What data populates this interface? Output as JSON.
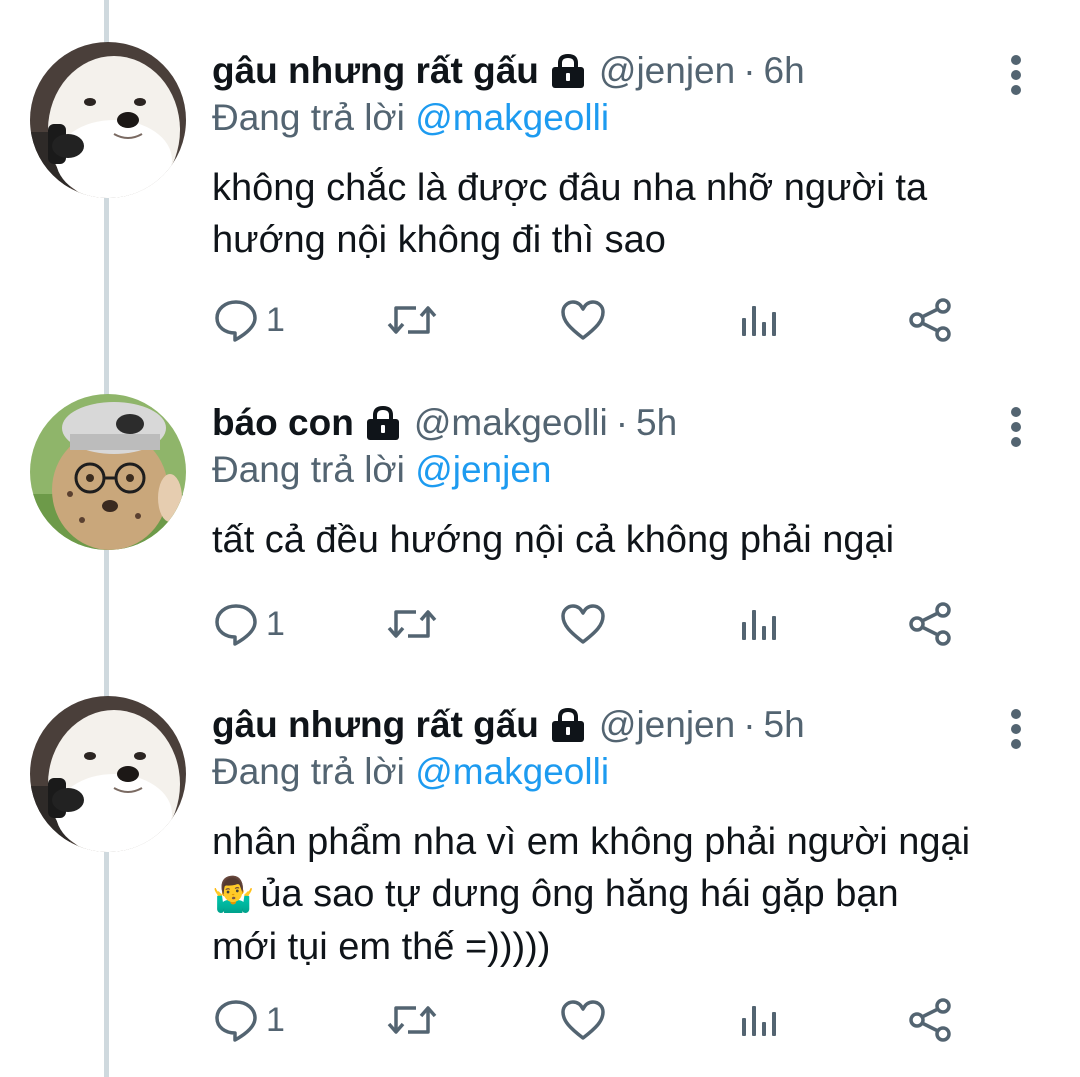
{
  "colors": {
    "text_primary": "#0f1419",
    "text_secondary": "#536471",
    "link": "#1d9bf0",
    "thread_line": "#cfd9de",
    "background": "#ffffff"
  },
  "tweets": [
    {
      "display_name": "gâu nhưng rất gấu",
      "protected_icon": "lock-icon",
      "handle": "@jenjen",
      "separator": "·",
      "time": "6h",
      "replying_prefix": "Đang trả lời",
      "replying_to": "@makgeolli",
      "text_lines": [
        "không chắc là được đâu nha nhỡ người ta",
        "hướng nội không đi thì sao"
      ],
      "reply_count": "1",
      "avatar": "samoyed-dog-avatar"
    },
    {
      "display_name": "báo con",
      "protected_icon": "lock-icon",
      "handle": "@makgeolli",
      "separator": "·",
      "time": "5h",
      "replying_prefix": "Đang trả lời",
      "replying_to": "@jenjen",
      "text_lines": [
        "tất cả đều hướng nội cả không phải ngại"
      ],
      "reply_count": "1",
      "avatar": "cheetah-cub-avatar"
    },
    {
      "display_name": "gâu nhưng rất gấu",
      "protected_icon": "lock-icon",
      "handle": "@jenjen",
      "separator": "·",
      "time": "5h",
      "replying_prefix": "Đang trả lời",
      "replying_to": "@makgeolli",
      "text_lines": [
        "nhân phẩm nha vì em không phải người ngại",
        "ủa sao tự dưng ông hăng hái gặp bạn",
        "mới tụi em thế =)))))"
      ],
      "shrug_emoji": "🤷‍♂️",
      "reply_count": "1",
      "avatar": "samoyed-dog-avatar"
    }
  ]
}
